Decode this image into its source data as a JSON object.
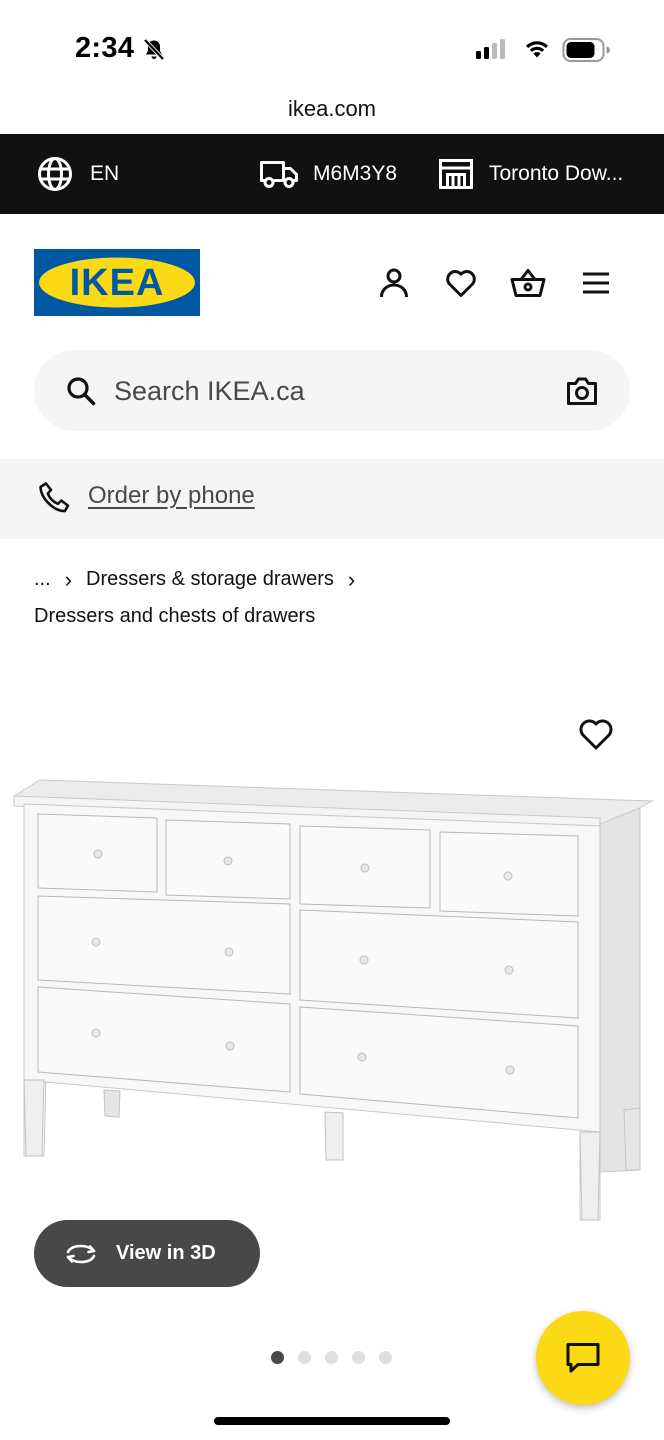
{
  "status_bar": {
    "time": "2:34",
    "url": "ikea.com"
  },
  "top_bar": {
    "language": "EN",
    "postal_code": "M6M3Y8",
    "store": "Toronto Dow..."
  },
  "header": {
    "logo_text": "IKEA",
    "logo_colors": {
      "blue": "#0058a3",
      "yellow": "#fbd914"
    }
  },
  "search": {
    "placeholder": "Search IKEA.ca"
  },
  "order_by_phone": {
    "label": "Order by phone"
  },
  "breadcrumb": {
    "items": [
      "...",
      "Dressers & storage drawers",
      "Dressers and chests of drawers"
    ],
    "separator": "›"
  },
  "product": {
    "view_3d_label": "View in 3D",
    "carousel_count": 5,
    "carousel_active": 1
  },
  "colors": {
    "top_bar_bg": "#111111",
    "search_bg": "#f5f5f5",
    "chat_button": "#fbd914",
    "view3d_bg": "#484848"
  }
}
